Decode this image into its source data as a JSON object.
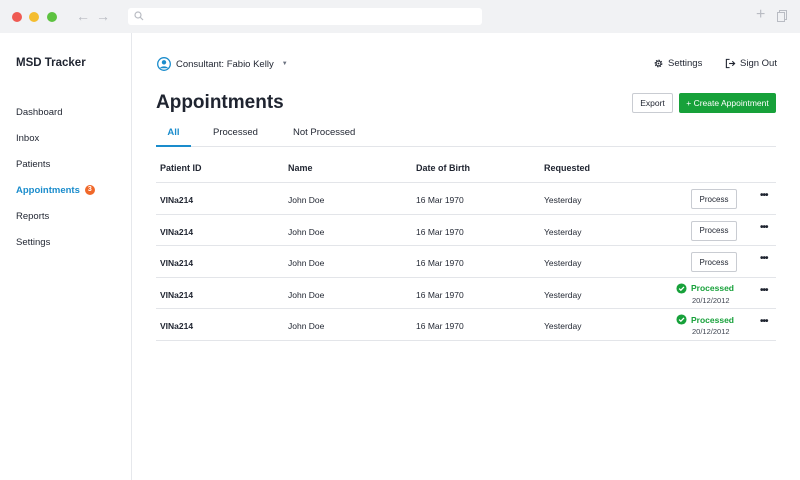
{
  "browser": {
    "back_icon": "←",
    "forward_icon": "→",
    "new_tab_icon": "+"
  },
  "app": {
    "title": "MSD Tracker"
  },
  "sidebar": {
    "items": [
      {
        "label": "Dashboard"
      },
      {
        "label": "Inbox"
      },
      {
        "label": "Patients"
      },
      {
        "label": "Appointments",
        "badge": "3",
        "active": true
      },
      {
        "label": "Reports"
      },
      {
        "label": "Settings"
      }
    ]
  },
  "header": {
    "consultant": "Consultant: Fabio Kelly",
    "settings_label": "Settings",
    "signout_label": "Sign Out"
  },
  "page": {
    "title": "Appointments",
    "export_label": "Export",
    "create_label": "+ Create Appointment"
  },
  "tabs": [
    {
      "label": "All",
      "active": true
    },
    {
      "label": "Processed"
    },
    {
      "label": "Not Processed"
    }
  ],
  "table": {
    "headers": [
      "Patient ID",
      "Name",
      "Date of Birth",
      "Requested"
    ],
    "process_label": "Process",
    "more_label": "•••",
    "rows": [
      {
        "id": "VINa214",
        "name": "John Doe",
        "dob": "16 Mar 1970",
        "requested": "Yesterday",
        "status": "pending"
      },
      {
        "id": "VINa214",
        "name": "John Doe",
        "dob": "16 Mar 1970",
        "requested": "Yesterday",
        "status": "pending"
      },
      {
        "id": "VINa214",
        "name": "John Doe",
        "dob": "16 Mar 1970",
        "requested": "Yesterday",
        "status": "pending"
      },
      {
        "id": "VINa214",
        "name": "John Doe",
        "dob": "16 Mar 1970",
        "requested": "Yesterday",
        "status": "processed",
        "status_label": "Processed",
        "status_date": "20/12/2012"
      },
      {
        "id": "VINa214",
        "name": "John Doe",
        "dob": "16 Mar 1970",
        "requested": "Yesterday",
        "status": "processed",
        "status_label": "Processed",
        "status_date": "20/12/2012"
      }
    ]
  },
  "colors": {
    "accent": "#1a8ccc",
    "primary_button": "#17a13a",
    "badge": "#f0682a",
    "processed": "#17a13a"
  }
}
